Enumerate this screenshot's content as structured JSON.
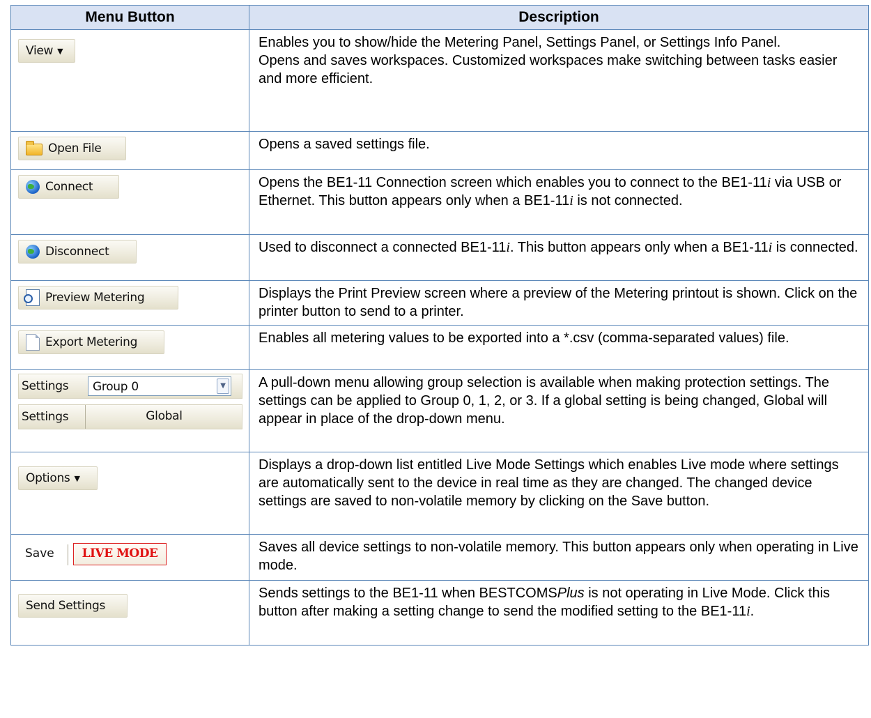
{
  "headers": {
    "menu_button": "Menu Button",
    "description": "Description"
  },
  "rows": [
    {
      "button_label": "View",
      "description": [
        "Enables you to show/hide the Metering Panel, Settings Panel, or Settings Info Panel.",
        "Opens and saves workspaces. Customized workspaces make switching between tasks easier and more efficient."
      ]
    },
    {
      "button_label": "Open File",
      "description": "Opens a saved settings file."
    },
    {
      "button_label": "Connect",
      "description_parts": [
        "Opens the BE1-11 Connection screen which enables you to connect to the BE1-11",
        "i",
        " via USB or Ethernet. This button appears only when a BE1-11",
        "i",
        " is not connected."
      ]
    },
    {
      "button_label": "Disconnect",
      "description_parts": [
        "Used to disconnect a connected BE1-11",
        "i",
        ". This button appears only when a BE1-11",
        "i",
        " is connected."
      ]
    },
    {
      "button_label": "Preview Metering",
      "description": "Displays the Print Preview screen where a preview of the Metering printout is shown. Click on the printer button to send to a printer."
    },
    {
      "button_label": "Export Metering",
      "description": "Enables all metering values to be exported into a *.csv (comma-separated values) file."
    },
    {
      "settings_label": "Settings",
      "group_value": "Group 0",
      "global_label": "Global",
      "description": "A pull-down menu allowing group selection is available when making protection settings. The settings can be applied to Group 0, 1, 2, or 3. If a global setting is being changed, Global will appear in place of the drop-down menu."
    },
    {
      "button_label": "Options",
      "description": "Displays a drop-down list entitled Live Mode Settings which enables Live mode where settings are automatically sent to the device in real time as they are changed. The changed device settings are saved to non-volatile memory by clicking on the Save button."
    },
    {
      "save_label": "Save",
      "live_label": "LIVE MODE",
      "description": "Saves all device settings to non-volatile memory. This button appears only when operating in Live mode."
    },
    {
      "button_label": "Send Settings",
      "description_parts": [
        "Sends settings to the BE1-11 when BESTCOMS",
        "Plus",
        " is not operating in Live Mode. Click this button after making a setting change to send the modified setting to the BE1-11",
        "i",
        "."
      ]
    }
  ],
  "icons": {
    "open_file": "folder-icon",
    "connect": "globe-icon",
    "disconnect": "globe-icon",
    "preview": "print-preview-icon",
    "export": "document-icon",
    "dropdown": "chevron-down-icon",
    "menu_caret": "caret-down-icon"
  },
  "colors": {
    "border": "#5a86b8",
    "header_bg": "#d9e2f3",
    "live_mode_red": "#e01212"
  }
}
